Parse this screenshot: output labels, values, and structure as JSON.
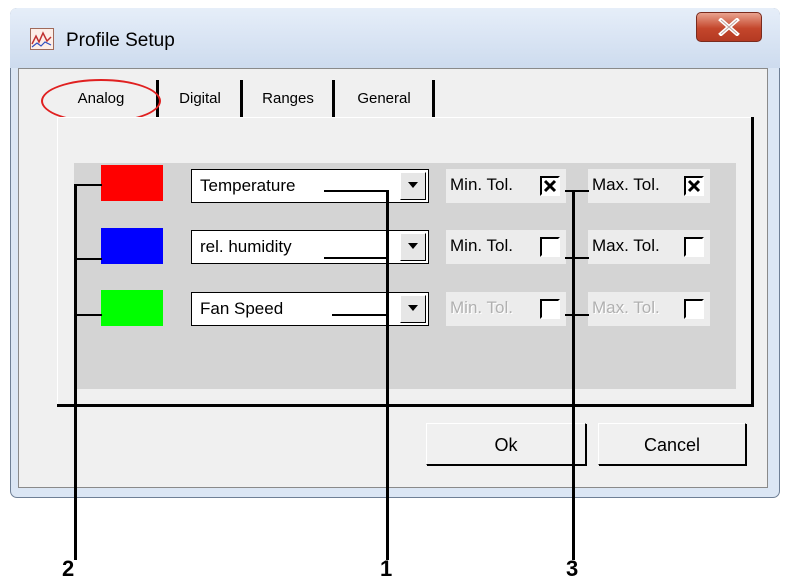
{
  "window": {
    "title": "Profile Setup",
    "close_icon": "close-icon"
  },
  "tabs": [
    {
      "label": "Analog",
      "selected": true
    },
    {
      "label": "Digital",
      "selected": false
    },
    {
      "label": "Ranges",
      "selected": false
    },
    {
      "label": "General",
      "selected": false
    }
  ],
  "channels": [
    {
      "color": "#ff0000",
      "value": "Temperature",
      "min_label": "Min. Tol.",
      "min_checked": true,
      "max_label": "Max. Tol.",
      "max_checked": true,
      "enabled": true
    },
    {
      "color": "#0000ff",
      "value": "rel. humidity",
      "min_label": "Min. Tol.",
      "min_checked": false,
      "max_label": "Max. Tol.",
      "max_checked": false,
      "enabled": true
    },
    {
      "color": "#00ff00",
      "value": "Fan Speed",
      "min_label": "Min. Tol.",
      "min_checked": false,
      "max_label": "Max. Tol.",
      "max_checked": false,
      "enabled": false
    }
  ],
  "buttons": {
    "ok": "Ok",
    "cancel": "Cancel"
  },
  "callouts": {
    "one": "1",
    "two": "2",
    "three": "3"
  },
  "colors": {
    "highlight": "#e02020"
  }
}
